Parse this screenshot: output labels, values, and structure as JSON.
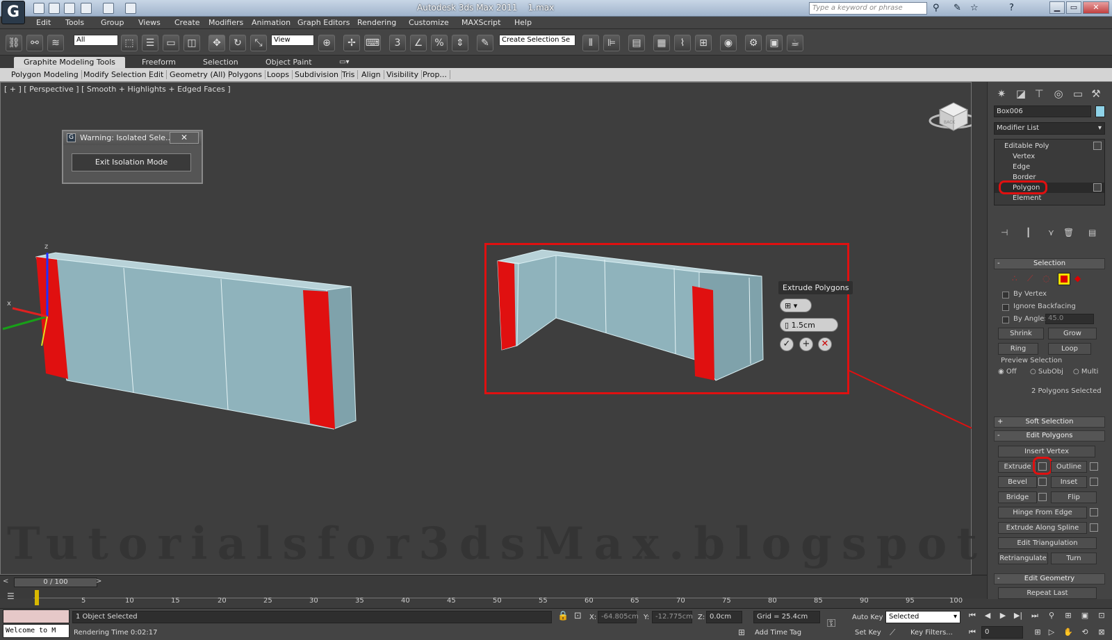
{
  "app": {
    "title": "Autodesk 3ds Max 2011",
    "filename": "1.max",
    "logo_glyph": "G",
    "search_placeholder": "Type a keyword or phrase"
  },
  "menu": [
    "Edit",
    "Tools",
    "Group",
    "Views",
    "Create",
    "Modifiers",
    "Animation",
    "Graph Editors",
    "Rendering",
    "Customize",
    "MAXScript",
    "Help"
  ],
  "toolbar": {
    "selection_filter": "All",
    "ref_coord": "View",
    "named_selection": "Create Selection Se",
    "snap_label": "3"
  },
  "ribbon": {
    "tabs": [
      "Graphite Modeling Tools",
      "Freeform",
      "Selection",
      "Object Paint"
    ],
    "items": [
      "Polygon Modeling",
      "Modify Selection",
      "Edit",
      "Geometry (All)",
      "Polygons",
      "Loops",
      "Subdivision",
      "Tris",
      "Align",
      "Visibility",
      "Prop..."
    ]
  },
  "viewport": {
    "label": "[ + ] [ Perspective ] [ Smooth + Highlights + Edged Faces ]",
    "watermark": "Tutorialsfor3dsMax.blogspot.com",
    "viewcube_label": "BACK"
  },
  "warning_dialog": {
    "title": "Warning: Isolated Sele...",
    "close_glyph": "✕",
    "button": "Exit Isolation Mode"
  },
  "caddy": {
    "title": "Extrude Polygons",
    "amount": "1.5cm"
  },
  "command_panel": {
    "object_name": "Box006",
    "modifier_list": "Modifier List",
    "stack": [
      "Editable Poly",
      "Vertex",
      "Edge",
      "Border",
      "Polygon",
      "Element"
    ],
    "selection": {
      "title": "Selection",
      "by_vertex": "By Vertex",
      "ignore_backfacing": "Ignore Backfacing",
      "by_angle": "By Angle:",
      "angle_value": "45.0",
      "shrink": "Shrink",
      "grow": "Grow",
      "ring": "Ring",
      "loop": "Loop",
      "preview_selection": "Preview Selection",
      "off": "Off",
      "subobj": "SubObj",
      "multi": "Multi",
      "status": "2 Polygons Selected"
    },
    "soft_selection": "Soft Selection",
    "edit_polygons": {
      "title": "Edit Polygons",
      "insert_vertex": "Insert Vertex",
      "extrude": "Extrude",
      "outline": "Outline",
      "bevel": "Bevel",
      "inset": "Inset",
      "bridge": "Bridge",
      "flip": "Flip",
      "hinge_from_edge": "Hinge From Edge",
      "extrude_along_spline": "Extrude Along Spline",
      "edit_triangulation": "Edit Triangulation",
      "retriangulate": "Retriangulate",
      "turn": "Turn"
    },
    "edit_geometry": {
      "title": "Edit Geometry",
      "repeat_last": "Repeat Last"
    }
  },
  "timeline": {
    "slider": "0 / 100",
    "ticks": [
      "5",
      "10",
      "15",
      "20",
      "25",
      "30",
      "35",
      "40",
      "45",
      "50",
      "55",
      "60",
      "65",
      "70",
      "75",
      "80",
      "85",
      "90",
      "95",
      "100"
    ]
  },
  "status": {
    "welcome": "Welcome to M",
    "selection": "1 Object Selected",
    "render_time": "Rendering Time  0:02:17",
    "x_label": "X:",
    "x_value": "-64.805cm",
    "y_label": "Y:",
    "y_value": "-12.775cm",
    "z_label": "Z:",
    "z_value": "0.0cm",
    "grid": "Grid = 25.4cm",
    "add_time_tag": "Add Time Tag",
    "auto_key": "Auto Key",
    "set_key": "Set Key",
    "key_mode": "Selected",
    "key_filters": "Key Filters...",
    "frame": "0"
  },
  "colors": {
    "selected_face": "#e01010",
    "mesh_face": "#9ab8c0",
    "highlight": "#e01010"
  }
}
